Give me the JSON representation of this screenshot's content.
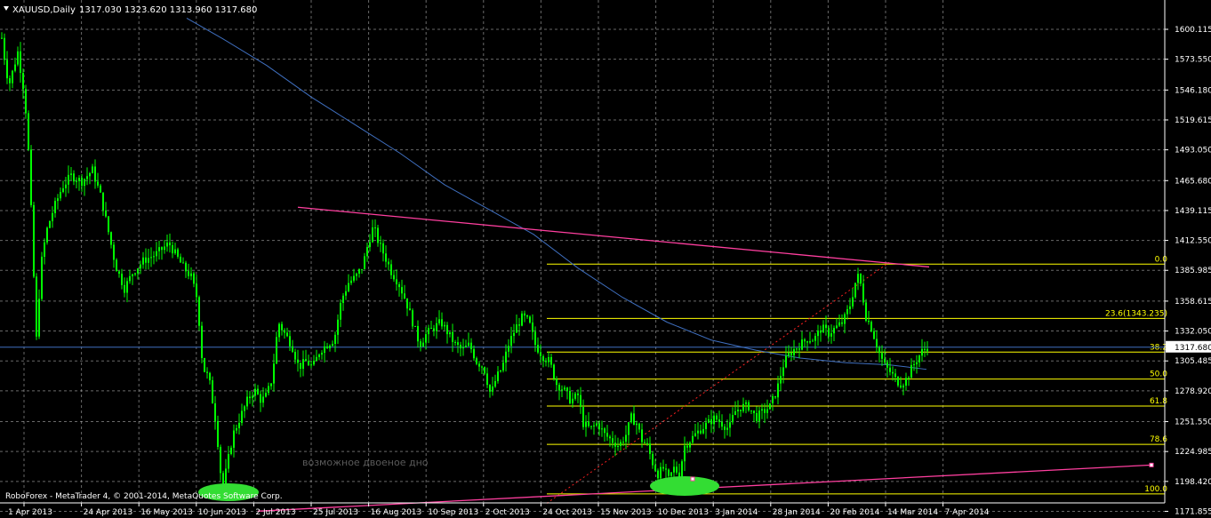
{
  "header": {
    "symbol": "XAUUSD,Daily",
    "ohlc": "1317.030 1323.620 1313.960 1317.680"
  },
  "copyright": "RoboForex - MetaTrader 4, © 2001-2014, MetaQuotes Software Corp.",
  "annotation": "возможное двоеное дно",
  "colors": {
    "background": "#000000",
    "candle": "#00ff00",
    "grid": "#c0c0c0",
    "moving_average": "#3f6fbf",
    "trendline": "#ff3f9f",
    "fibo": "#ffff00",
    "fibo_diag": "#ff2020",
    "price_line": "#3f6fbf",
    "ellipse": "#33dd33",
    "axis_text": "#ffffff"
  },
  "chart_data": {
    "type": "candlestick",
    "title": "XAUUSD,Daily",
    "last_price": 1317.68,
    "ylim": [
      1165,
      1615
    ],
    "y_ticks": [
      1600.115,
      1573.55,
      1546.18,
      1519.615,
      1493.05,
      1465.68,
      1439.115,
      1412.55,
      1385.985,
      1358.615,
      1332.05,
      1305.485,
      1278.92,
      1251.55,
      1224.985,
      1198.42,
      1171.855
    ],
    "x_ticks": [
      "1 Apr 2013",
      "24 Apr 2013",
      "16 May 2013",
      "10 Jun 2013",
      "2 Jul 2013",
      "25 Jul 2013",
      "16 Aug 2013",
      "10 Sep 2013",
      "2 Oct 2013",
      "24 Oct 2013",
      "15 Nov 2013",
      "10 Dec 2013",
      "3 Jan 2014",
      "28 Jan 2014",
      "20 Feb 2014",
      "14 Mar 2014",
      "7 Apr 2014"
    ],
    "price_path": [
      [
        0,
        1605
      ],
      [
        4,
        1580
      ],
      [
        10,
        1550
      ],
      [
        20,
        1580
      ],
      [
        28,
        1540
      ],
      [
        33,
        1480
      ],
      [
        38,
        1380
      ],
      [
        41,
        1325
      ],
      [
        46,
        1390
      ],
      [
        52,
        1420
      ],
      [
        60,
        1440
      ],
      [
        70,
        1460
      ],
      [
        80,
        1470
      ],
      [
        92,
        1465
      ],
      [
        104,
        1475
      ],
      [
        114,
        1450
      ],
      [
        122,
        1420
      ],
      [
        130,
        1390
      ],
      [
        140,
        1370
      ],
      [
        150,
        1385
      ],
      [
        162,
        1395
      ],
      [
        175,
        1400
      ],
      [
        190,
        1410
      ],
      [
        205,
        1390
      ],
      [
        215,
        1380
      ],
      [
        222,
        1360
      ],
      [
        228,
        1300
      ],
      [
        235,
        1290
      ],
      [
        243,
        1250
      ],
      [
        250,
        1190
      ],
      [
        256,
        1215
      ],
      [
        262,
        1240
      ],
      [
        270,
        1255
      ],
      [
        278,
        1270
      ],
      [
        286,
        1280
      ],
      [
        294,
        1270
      ],
      [
        300,
        1275
      ],
      [
        306,
        1290
      ],
      [
        313,
        1340
      ],
      [
        320,
        1330
      ],
      [
        328,
        1320
      ],
      [
        336,
        1300
      ],
      [
        344,
        1305
      ],
      [
        352,
        1300
      ],
      [
        360,
        1315
      ],
      [
        368,
        1320
      ],
      [
        376,
        1325
      ],
      [
        384,
        1360
      ],
      [
        392,
        1375
      ],
      [
        400,
        1380
      ],
      [
        408,
        1390
      ],
      [
        414,
        1410
      ],
      [
        420,
        1425
      ],
      [
        426,
        1410
      ],
      [
        432,
        1400
      ],
      [
        440,
        1385
      ],
      [
        448,
        1375
      ],
      [
        456,
        1360
      ],
      [
        464,
        1340
      ],
      [
        472,
        1320
      ],
      [
        480,
        1330
      ],
      [
        488,
        1335
      ],
      [
        496,
        1340
      ],
      [
        504,
        1330
      ],
      [
        512,
        1320
      ],
      [
        520,
        1315
      ],
      [
        528,
        1320
      ],
      [
        536,
        1305
      ],
      [
        544,
        1300
      ],
      [
        552,
        1275
      ],
      [
        558,
        1290
      ],
      [
        565,
        1300
      ],
      [
        572,
        1320
      ],
      [
        580,
        1335
      ],
      [
        588,
        1345
      ],
      [
        595,
        1340
      ],
      [
        602,
        1320
      ],
      [
        610,
        1310
      ],
      [
        618,
        1305
      ],
      [
        626,
        1285
      ],
      [
        634,
        1280
      ],
      [
        642,
        1270
      ],
      [
        650,
        1275
      ],
      [
        656,
        1250
      ],
      [
        664,
        1245
      ],
      [
        672,
        1250
      ],
      [
        680,
        1240
      ],
      [
        688,
        1235
      ],
      [
        696,
        1230
      ],
      [
        704,
        1240
      ],
      [
        710,
        1255
      ],
      [
        716,
        1250
      ],
      [
        722,
        1235
      ],
      [
        728,
        1230
      ],
      [
        734,
        1215
      ],
      [
        740,
        1205
      ],
      [
        746,
        1210
      ],
      [
        752,
        1200
      ],
      [
        758,
        1210
      ],
      [
        764,
        1205
      ],
      [
        770,
        1230
      ],
      [
        776,
        1235
      ],
      [
        782,
        1240
      ],
      [
        788,
        1245
      ],
      [
        796,
        1250
      ],
      [
        804,
        1255
      ],
      [
        812,
        1250
      ],
      [
        820,
        1245
      ],
      [
        826,
        1260
      ],
      [
        834,
        1265
      ],
      [
        842,
        1265
      ],
      [
        850,
        1255
      ],
      [
        858,
        1260
      ],
      [
        866,
        1265
      ],
      [
        874,
        1280
      ],
      [
        880,
        1300
      ],
      [
        886,
        1310
      ],
      [
        892,
        1315
      ],
      [
        900,
        1320
      ],
      [
        908,
        1325
      ],
      [
        916,
        1325
      ],
      [
        924,
        1335
      ],
      [
        932,
        1330
      ],
      [
        940,
        1335
      ],
      [
        948,
        1340
      ],
      [
        956,
        1355
      ],
      [
        962,
        1375
      ],
      [
        966,
        1382
      ],
      [
        970,
        1365
      ],
      [
        974,
        1345
      ],
      [
        980,
        1335
      ],
      [
        986,
        1320
      ],
      [
        990,
        1310
      ],
      [
        996,
        1300
      ],
      [
        1002,
        1295
      ],
      [
        1008,
        1288
      ],
      [
        1014,
        1285
      ],
      [
        1020,
        1290
      ],
      [
        1026,
        1300
      ],
      [
        1032,
        1308
      ],
      [
        1038,
        1315
      ],
      [
        1043,
        1318
      ]
    ],
    "moving_average_path": [
      [
        210,
        1610
      ],
      [
        250,
        1592
      ],
      [
        300,
        1568
      ],
      [
        350,
        1540
      ],
      [
        400,
        1515
      ],
      [
        450,
        1490
      ],
      [
        500,
        1462
      ],
      [
        550,
        1440
      ],
      [
        600,
        1418
      ],
      [
        650,
        1388
      ],
      [
        700,
        1362
      ],
      [
        750,
        1340
      ],
      [
        800,
        1324
      ],
      [
        850,
        1315
      ],
      [
        900,
        1308
      ],
      [
        950,
        1304
      ],
      [
        1000,
        1302
      ],
      [
        1042,
        1298
      ]
    ],
    "trendlines": [
      {
        "from": [
          335,
          1442
        ],
        "to": [
          1045,
          1389
        ]
      },
      {
        "from": [
          290,
          1172
        ],
        "to": [
          1295,
          1213
        ]
      }
    ],
    "fibo_levels": [
      {
        "label": "0.0",
        "price": 1391.5
      },
      {
        "label": "23.6(1343.235)",
        "price": 1343.235
      },
      {
        "label": "38.2",
        "price": 1313.3
      },
      {
        "label": "50.0",
        "price": 1289.4
      },
      {
        "label": "61.8",
        "price": 1265.4
      },
      {
        "label": "78.6",
        "price": 1231.3
      },
      {
        "label": "100.0",
        "price": 1187.3
      }
    ],
    "fibo_diagonal": {
      "from": [
        615,
        1179
      ],
      "to": [
        1000,
        1393
      ]
    }
  }
}
